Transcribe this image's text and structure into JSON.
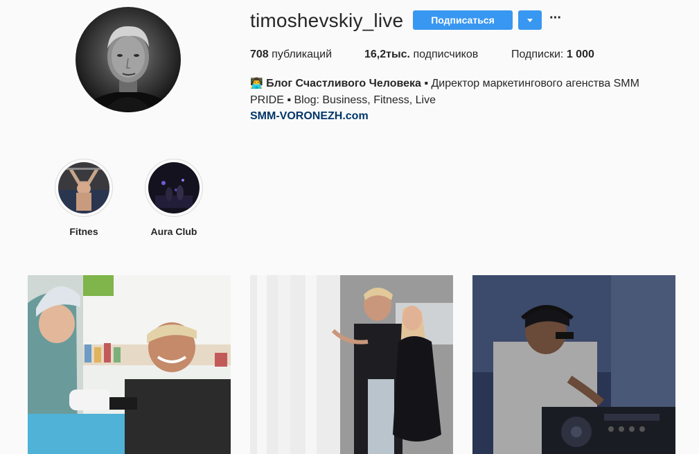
{
  "profile": {
    "username": "timoshevskiy_live",
    "follow_label": "Подписаться",
    "stats": {
      "posts_count": "708",
      "posts_label": "публикаций",
      "followers_count": "16,2тыс.",
      "followers_label": "подписчиков",
      "following_label": "Подписки:",
      "following_count": "1 000"
    },
    "bio": {
      "emoji": "👨‍💻",
      "title": "Блог Счастливого Человека",
      "text_1": " ▪ Директор маркетингового агенства SMM",
      "text_2": "PRIDE ▪ Blog: Business, Fitness, Live",
      "link": "SMM-VORONEZH.com"
    }
  },
  "highlights": [
    {
      "label": "Fitnes"
    },
    {
      "label": "Aura Club"
    }
  ],
  "colors": {
    "accent": "#3897f0",
    "link": "#003569",
    "background": "#fafafa",
    "text": "#262626"
  },
  "icons": {
    "dropdown": "chevron-down-icon",
    "more": "more-options-icon"
  }
}
